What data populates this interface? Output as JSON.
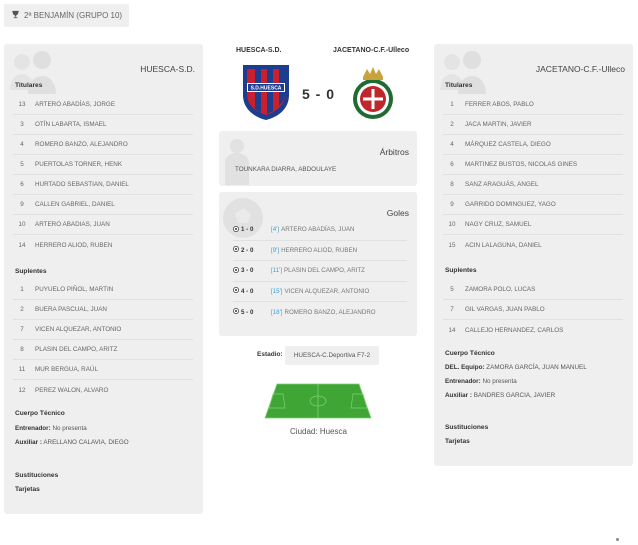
{
  "competition": {
    "icon": "trophy-icon",
    "label": "2ª BENJAMÍN (GRUPO 10)"
  },
  "match": {
    "home_team": "HUESCA-S.D.",
    "away_team": "JACETANO-C.F.-Ulleco",
    "score": "5 - 0"
  },
  "home": {
    "title": "HUESCA-S.D.",
    "starters_label": "Titulares",
    "starters": [
      {
        "num": "13",
        "name": "ARTERO ABADÍAS, JORGE"
      },
      {
        "num": "3",
        "name": "OTÍN LABARTA, ISMAEL"
      },
      {
        "num": "4",
        "name": "ROMERO BANZO, ALEJANDRO"
      },
      {
        "num": "5",
        "name": "PUERTOLAS TORNER, HENK"
      },
      {
        "num": "6",
        "name": "HURTADO SEBASTIAN, DANIEL"
      },
      {
        "num": "9",
        "name": "CALLEN GABRIEL, DANIEL"
      },
      {
        "num": "10",
        "name": "ARTERO ABADIAS, JUAN"
      },
      {
        "num": "14",
        "name": "HERRERO ALIOD, RUBEN"
      }
    ],
    "subs_label": "Suplentes",
    "subs": [
      {
        "num": "1",
        "name": "PUYUELO PIÑOL, MARTIN"
      },
      {
        "num": "2",
        "name": "BUERA PASCUAL, JUAN"
      },
      {
        "num": "7",
        "name": "VICEN ALQUEZAR, ANTONIO"
      },
      {
        "num": "8",
        "name": "PLASIN DEL CAMPO, ARITZ"
      },
      {
        "num": "11",
        "name": "MUR BERGUA, RAÚL"
      },
      {
        "num": "12",
        "name": "PEREZ WALON, ALVARO"
      }
    ],
    "staff_label": "Cuerpo Técnico",
    "coach_label": "Entrenador:",
    "coach_value": "No presenta",
    "assistant_label": "Auxiliar :",
    "assistant_value": "ARELLANO CALAVIA, DIEGO",
    "substitutions_label": "Sustituciones",
    "cards_label": "Tarjetas"
  },
  "away": {
    "title": "JACETANO-C.F.-Ulleco",
    "starters_label": "Titulares",
    "starters": [
      {
        "num": "1",
        "name": "FERRER ABOS, PABLO"
      },
      {
        "num": "2",
        "name": "JACA MARTIN, JAVIER"
      },
      {
        "num": "4",
        "name": "MÁRQUEZ CASTELA, DIEGO"
      },
      {
        "num": "6",
        "name": "MARTINEZ BUSTOS, NICOLAS GINES"
      },
      {
        "num": "8",
        "name": "SANZ ARAGUÁS, ANGEL"
      },
      {
        "num": "9",
        "name": "GARRIDO DOMINGUEZ, YAGO"
      },
      {
        "num": "10",
        "name": "NAGY CRUZ, SAMUEL"
      },
      {
        "num": "15",
        "name": "ACIN LALAGUNA, DANIEL"
      }
    ],
    "subs_label": "Suplentes",
    "subs": [
      {
        "num": "5",
        "name": "ZAMORA POLO, LUCAS"
      },
      {
        "num": "7",
        "name": "GIL VARGAS, JUAN PABLO"
      },
      {
        "num": "14",
        "name": "CALLEJO HERNANDEZ, CARLOS"
      }
    ],
    "staff_label": "Cuerpo Técnico",
    "delegate_label": "DEL. Equipo:",
    "delegate_value": "ZAMORA GARCÍA, JUAN MANUEL",
    "coach_label": "Entrenador:",
    "coach_value": "No presenta",
    "assistant_label": "Auxiliar :",
    "assistant_value": "BANDRES GARCIA, JAVIER",
    "substitutions_label": "Sustituciones",
    "cards_label": "Tarjetas"
  },
  "referees": {
    "title": "Árbitros",
    "name": "TOUNKARA DIARRA, ABDOULAYE"
  },
  "goals": {
    "title": "Goles",
    "items": [
      {
        "score": "1 - 0",
        "minute": "[4']",
        "player": "ARTERO ABADÍAS, JUAN"
      },
      {
        "score": "2 - 0",
        "minute": "[9']",
        "player": "HERRERO ALIOD, RUBEN"
      },
      {
        "score": "3 - 0",
        "minute": "[11']",
        "player": "PLASIN DEL CAMPO, ARITZ"
      },
      {
        "score": "4 - 0",
        "minute": "[15']",
        "player": "VICEN ALQUEZAR, ANTONIO"
      },
      {
        "score": "5 - 0",
        "minute": "[18']",
        "player": "ROMERO BANZO, ALEJANDRO"
      }
    ]
  },
  "venue": {
    "stadium_label": "Estadio:",
    "stadium_name": "HUESCA-C.Deportiva F7-2",
    "city": "Ciudad: Huesca"
  },
  "colors": {
    "link": "#3a9fd6",
    "panel": "#efefef",
    "pitch": "#3fa534",
    "home_blue": "#1d3d8f",
    "home_red": "#c8202f",
    "away_green": "#1f6b32",
    "away_red": "#c0272d"
  }
}
